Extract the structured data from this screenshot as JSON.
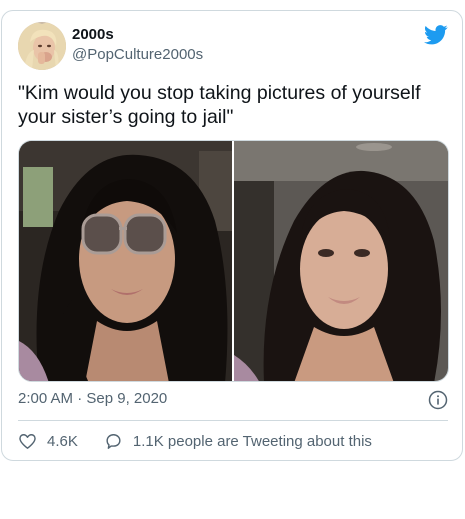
{
  "author": {
    "display_name": "2000s",
    "handle": "@PopCulture2000s",
    "avatar_icon": "profile-photo",
    "brand_icon": "twitter-bird-icon"
  },
  "tweet": {
    "text": "\"Kim would you stop taking pictures of yourself your sister’s going to jail\"",
    "timestamp": "2:00 AM · Sep 9, 2020"
  },
  "media": {
    "photo_count": 2
  },
  "actions": {
    "like_count": "4.6K",
    "reply_text": "1.1K people are Tweeting about this"
  },
  "colors": {
    "brand_blue": "#1d9bf0",
    "secondary_text": "#536471",
    "border": "#cfd9de"
  }
}
